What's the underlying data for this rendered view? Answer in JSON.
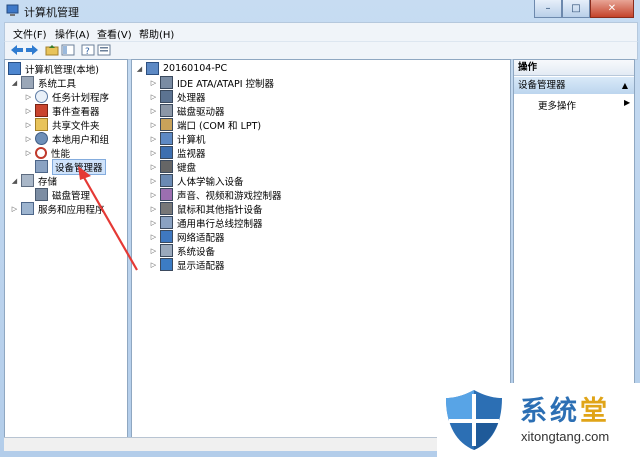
{
  "window": {
    "title": "计算机管理",
    "title_icon": "computer-management-icon"
  },
  "caption": {
    "minimize": "–",
    "maximize": "□",
    "close": "✕"
  },
  "menu": [
    "文件(F)",
    "操作(A)",
    "查看(V)",
    "帮助(H)"
  ],
  "toolbar": [
    "back-icon",
    "forward-icon",
    "up-folder-icon",
    "show-hide-tree-icon",
    "help-icon",
    "properties-icon"
  ],
  "tree": {
    "root": "计算机管理(本地)",
    "system_tools": "系统工具",
    "items": [
      "任务计划程序",
      "事件查看器",
      "共享文件夹",
      "本地用户和组",
      "性能",
      "设备管理器"
    ],
    "storage": "存储",
    "disk": "磁盘管理",
    "services": "服务和应用程序"
  },
  "devices": {
    "computer_name": "20160104-PC",
    "categories": [
      "IDE ATA/ATAPI 控制器",
      "处理器",
      "磁盘驱动器",
      "端口 (COM 和 LPT)",
      "计算机",
      "监视器",
      "键盘",
      "人体学输入设备",
      "声音、视频和游戏控制器",
      "鼠标和其他指针设备",
      "通用串行总线控制器",
      "网络适配器",
      "系统设备",
      "显示适配器"
    ]
  },
  "actions": {
    "header": "操作",
    "section": "设备管理器",
    "more": "更多操作"
  },
  "watermark": {
    "cn_main": "系统",
    "cn_last": "堂",
    "url": "xitongtang.com"
  },
  "colors": {
    "accent": "#2c6fb4",
    "arrow": "#e53935",
    "watermark_gold": "#e0a418"
  }
}
